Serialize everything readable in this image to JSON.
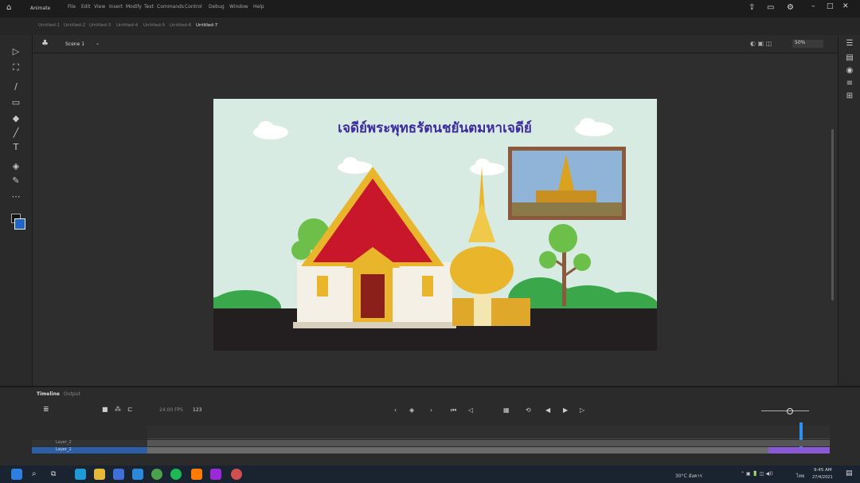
{
  "app": {
    "name": "Animate"
  },
  "menu": [
    "File",
    "Edit",
    "View",
    "Insert",
    "Modify",
    "Text",
    "Commands",
    "Control",
    "Debug",
    "Window",
    "Help"
  ],
  "file_tabs": [
    "Untitled-1",
    "Untitled-2",
    "Untitled-3",
    "Untitled-4",
    "Untitled-5",
    "Untitled-6",
    "Untitled-7"
  ],
  "scene": {
    "label": "Scene 1",
    "zoom": "50%"
  },
  "stage": {
    "title": "เจดีย์พระพุทธรัตนชยันตมหาเจดีย์",
    "colors": {
      "bg": "#d7ebe2",
      "ground": "#231f20",
      "hills": "#3aa84a",
      "roof": "#c8162b",
      "gold": "#e8b52b"
    }
  },
  "timeline": {
    "tab_label": "Timeline",
    "tab2_label": "Output",
    "fps": "24.00 FPS",
    "frame": "123",
    "layers": [
      "Layer_2",
      "Layer_1"
    ]
  },
  "taskbar": {
    "weather": "30°C อังคาร",
    "time": "9:45 AM",
    "date": "27/4/2021",
    "lang": "ไทย"
  }
}
